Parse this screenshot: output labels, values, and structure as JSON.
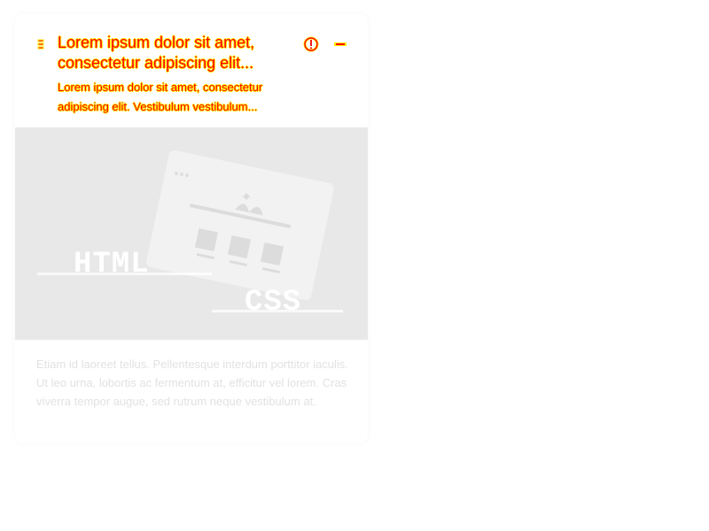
{
  "card": {
    "title": "Lorem ipsum dolor sit amet, consectetur adipiscing elit...",
    "subtitle": "Lorem ipsum dolor sit amet, consectetur adipiscing elit. Vestibulum vestibulum...",
    "media": {
      "label_html": "HTML",
      "label_css": "CSS"
    },
    "body": "Etiam id laoreet tellus. Pellentesque interdum porttitor iaculis. Ut leo urna, lobortis ac fermentum at, efficitur vel lorem. Cras viverra tempor augue, sed rutrum neque vestibulum at."
  },
  "icons": {
    "drag": "drag-handle-icon",
    "menu": "info-icon",
    "collapse": "minus-icon"
  },
  "colors": {
    "title": "#ff0000",
    "title_outline": "#ffee00",
    "media_bg": "#e8e8e8",
    "body_text": "#e2e2e2"
  }
}
